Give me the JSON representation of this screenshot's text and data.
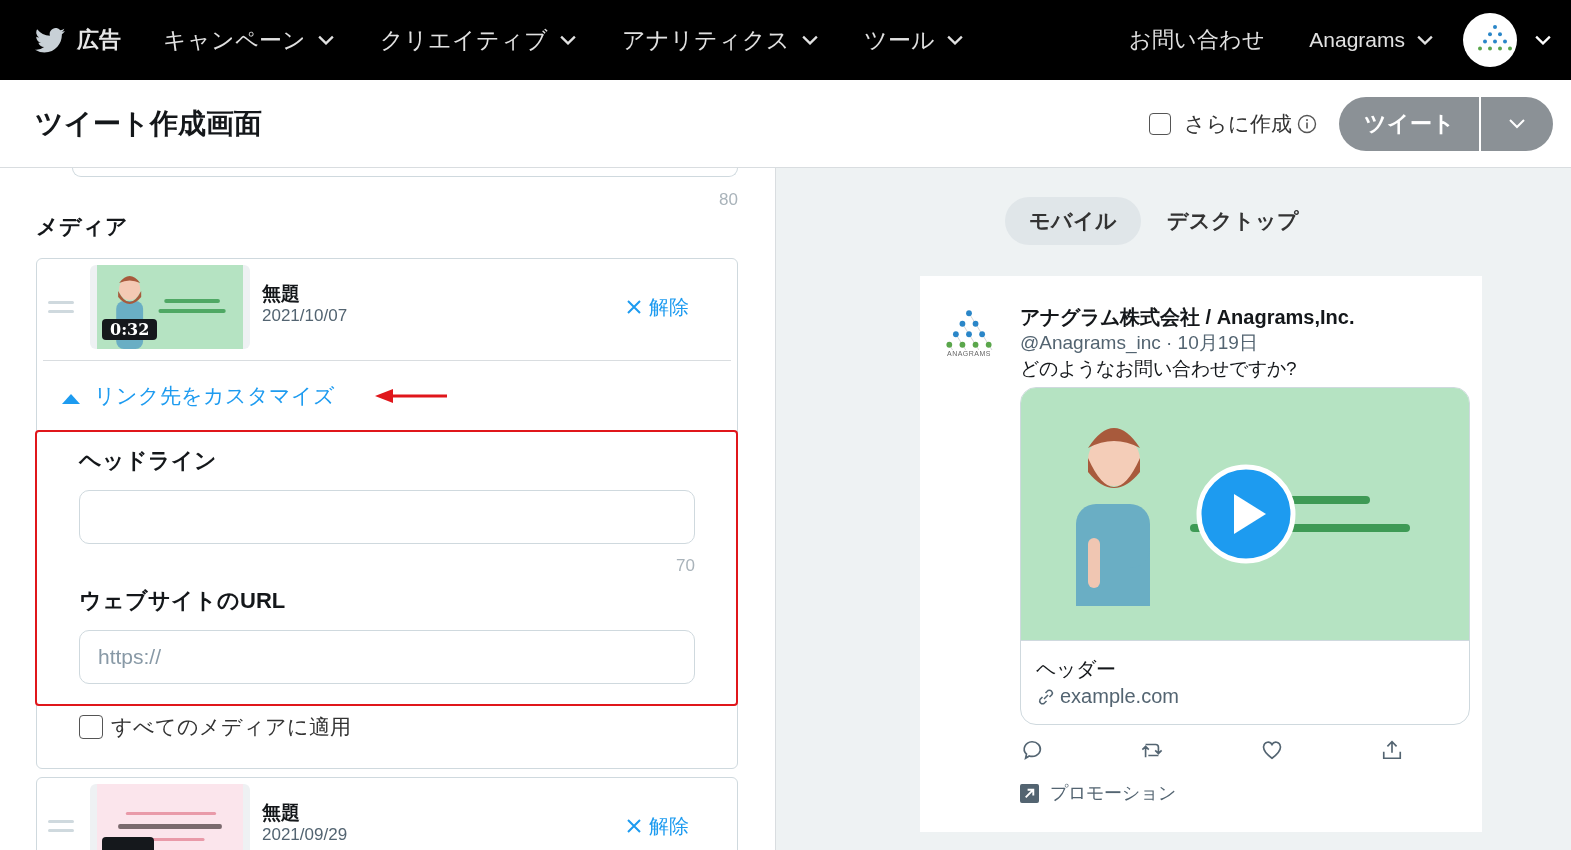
{
  "nav": {
    "brand": "広告",
    "menus": [
      "キャンペーン",
      "クリエイティブ",
      "アナリティクス",
      "ツール"
    ],
    "contact": "お問い合わせ",
    "account": "Anagrams"
  },
  "header": {
    "title": "ツイート作成画面",
    "create_more": {
      "label": "さらに作成",
      "checked": false
    },
    "tweet_button": "ツイート"
  },
  "editor": {
    "char_count": "80",
    "media_heading": "メディア",
    "media": [
      {
        "title": "無題",
        "date": "2021/10/07",
        "duration": "0:32",
        "remove": "解除",
        "customize": {
          "label": "リンク先をカスタマイズ",
          "expanded": true,
          "headline_label": "ヘッドライン",
          "headline_count": "70",
          "url_label": "ウェブサイトのURL",
          "url_placeholder": "https://",
          "apply_all": {
            "label": "すべてのメディアに適用",
            "checked": false
          }
        }
      },
      {
        "title": "無題",
        "date": "2021/09/29",
        "remove": "解除"
      }
    ]
  },
  "preview": {
    "tabs": [
      {
        "label": "モバイル",
        "selected": true
      },
      {
        "label": "デスクトップ",
        "selected": false
      }
    ],
    "tweet": {
      "logo_text": "ANAGRAMS",
      "name": "アナグラム株式会社 / Anagrams,Inc.",
      "meta": "@Anagrams_inc · 10月19日",
      "text": "どのようなお問い合わせですか?",
      "card": {
        "headline": "ヘッダー",
        "domain": "example.com"
      },
      "promoted": "プロモーション"
    }
  }
}
